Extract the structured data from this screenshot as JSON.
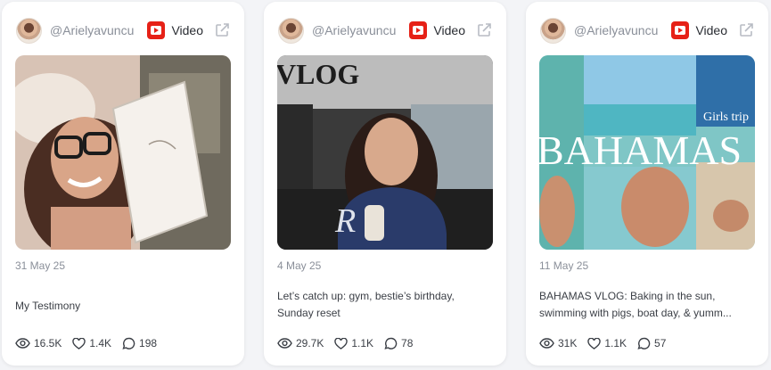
{
  "cards": [
    {
      "handle": "@Arielyavuncu",
      "platform": "Video",
      "platform_icon": "youtube-icon",
      "date": "31 May 25",
      "caption": "My Testimony",
      "views": "16.5K",
      "likes": "1.4K",
      "comments": "198"
    },
    {
      "handle": "@Arielyavuncu",
      "platform": "Video",
      "platform_icon": "youtube-icon",
      "date": "4 May 25",
      "caption": "Let’s catch up: gym, bestie’s birthday, Sunday reset",
      "thumb_text": "VLOG",
      "views": "29.7K",
      "likes": "1.1K",
      "comments": "78"
    },
    {
      "handle": "@Arielyavuncu",
      "platform": "Video",
      "platform_icon": "youtube-icon",
      "date": "11 May 25",
      "caption": "BAHAMAS VLOG: Baking in the sun, swimming with pigs, boat day, & yumm...",
      "thumb_text": "BAHAMAS",
      "thumb_subtext": "Girls trip",
      "views": "31K",
      "likes": "1.1K",
      "comments": "57"
    }
  ],
  "colors": {
    "youtube": "#e62117",
    "muted_text": "#8a8f99",
    "body_text": "#3b3f46"
  }
}
